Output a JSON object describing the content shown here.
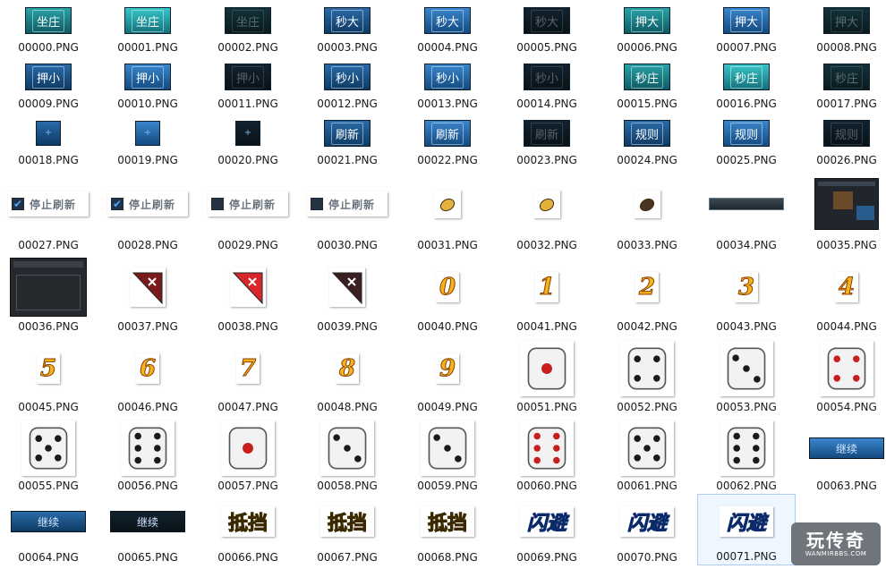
{
  "files": [
    {
      "name": "00000.PNG",
      "kind": "btn",
      "style": "teal",
      "label": "坐庄"
    },
    {
      "name": "00001.PNG",
      "kind": "btn",
      "style": "teal-b",
      "label": "坐庄"
    },
    {
      "name": "00002.PNG",
      "kind": "btn",
      "style": "dark",
      "label": "坐庄"
    },
    {
      "name": "00003.PNG",
      "kind": "btn",
      "style": "blue",
      "label": "秒大"
    },
    {
      "name": "00004.PNG",
      "kind": "btn",
      "style": "blue-b",
      "label": "秒大"
    },
    {
      "name": "00005.PNG",
      "kind": "btn",
      "style": "darkb",
      "label": "秒大"
    },
    {
      "name": "00006.PNG",
      "kind": "btn",
      "style": "teal",
      "label": "押大"
    },
    {
      "name": "00007.PNG",
      "kind": "btn",
      "style": "blue-b",
      "label": "押大"
    },
    {
      "name": "00008.PNG",
      "kind": "btn",
      "style": "dark",
      "label": "押大"
    },
    {
      "name": "00009.PNG",
      "kind": "btn",
      "style": "blue",
      "label": "押小"
    },
    {
      "name": "00010.PNG",
      "kind": "btn",
      "style": "blue-b",
      "label": "押小"
    },
    {
      "name": "00011.PNG",
      "kind": "btn",
      "style": "darkb",
      "label": "押小"
    },
    {
      "name": "00012.PNG",
      "kind": "btn",
      "style": "blue",
      "label": "秒小"
    },
    {
      "name": "00013.PNG",
      "kind": "btn",
      "style": "blue-b",
      "label": "秒小"
    },
    {
      "name": "00014.PNG",
      "kind": "btn",
      "style": "darkb",
      "label": "秒小"
    },
    {
      "name": "00015.PNG",
      "kind": "btn",
      "style": "teal",
      "label": "秒庄"
    },
    {
      "name": "00016.PNG",
      "kind": "btn",
      "style": "teal-b",
      "label": "秒庄"
    },
    {
      "name": "00017.PNG",
      "kind": "btn",
      "style": "dark",
      "label": "秒庄"
    },
    {
      "name": "00018.PNG",
      "kind": "sq",
      "style": "blue"
    },
    {
      "name": "00019.PNG",
      "kind": "sq",
      "style": "blue-b"
    },
    {
      "name": "00020.PNG",
      "kind": "sq",
      "style": "darkb"
    },
    {
      "name": "00021.PNG",
      "kind": "btn",
      "style": "blue",
      "label": "刷新"
    },
    {
      "name": "00022.PNG",
      "kind": "btn",
      "style": "blue-b",
      "label": "刷新"
    },
    {
      "name": "00023.PNG",
      "kind": "btn",
      "style": "darkb",
      "label": "刷新"
    },
    {
      "name": "00024.PNG",
      "kind": "btn",
      "style": "blue",
      "label": "规则"
    },
    {
      "name": "00025.PNG",
      "kind": "btn",
      "style": "blue-b",
      "label": "规则"
    },
    {
      "name": "00026.PNG",
      "kind": "btn",
      "style": "darkb",
      "label": "规则"
    },
    {
      "name": "00027.PNG",
      "kind": "stop",
      "checked": true,
      "label": "停止刷新"
    },
    {
      "name": "00028.PNG",
      "kind": "stop",
      "checked": true,
      "label": "停止刷新"
    },
    {
      "name": "00029.PNG",
      "kind": "stop",
      "checked": false,
      "label": "停止刷新"
    },
    {
      "name": "00030.PNG",
      "kind": "stop",
      "checked": false,
      "label": "停止刷新"
    },
    {
      "name": "00031.PNG",
      "kind": "coin",
      "color": "#e4b23a"
    },
    {
      "name": "00032.PNG",
      "kind": "coin",
      "color": "#e4b23a"
    },
    {
      "name": "00033.PNG",
      "kind": "coin",
      "color": "#4a3424"
    },
    {
      "name": "00034.PNG",
      "kind": "bar"
    },
    {
      "name": "00035.PNG",
      "kind": "panel"
    },
    {
      "name": "00036.PNG",
      "kind": "panel2"
    },
    {
      "name": "00037.PNG",
      "kind": "corner",
      "color": "#7a1a1a"
    },
    {
      "name": "00038.PNG",
      "kind": "corner",
      "color": "#d8262a"
    },
    {
      "name": "00039.PNG",
      "kind": "corner",
      "color": "#3a2020"
    },
    {
      "name": "00040.PNG",
      "kind": "digit",
      "label": "0"
    },
    {
      "name": "00041.PNG",
      "kind": "digit",
      "label": "1"
    },
    {
      "name": "00042.PNG",
      "kind": "digit",
      "label": "2"
    },
    {
      "name": "00043.PNG",
      "kind": "digit",
      "label": "3"
    },
    {
      "name": "00044.PNG",
      "kind": "digit",
      "label": "4"
    },
    {
      "name": "00045.PNG",
      "kind": "digit",
      "label": "5"
    },
    {
      "name": "00046.PNG",
      "kind": "digit",
      "label": "6"
    },
    {
      "name": "00047.PNG",
      "kind": "digit",
      "label": "7"
    },
    {
      "name": "00048.PNG",
      "kind": "digit",
      "label": "8"
    },
    {
      "name": "00049.PNG",
      "kind": "digit",
      "label": "9"
    },
    {
      "name": "00051.PNG",
      "kind": "die",
      "pips": 1,
      "red": true
    },
    {
      "name": "00052.PNG",
      "kind": "die",
      "pips": 4,
      "red": false
    },
    {
      "name": "00053.PNG",
      "kind": "die",
      "pips": 3,
      "red": false
    },
    {
      "name": "00054.PNG",
      "kind": "die",
      "pips": 4,
      "red": true
    },
    {
      "name": "00055.PNG",
      "kind": "die",
      "pips": 5,
      "red": false
    },
    {
      "name": "00056.PNG",
      "kind": "die",
      "pips": 6,
      "red": false
    },
    {
      "name": "00057.PNG",
      "kind": "die",
      "pips": 1,
      "red": true
    },
    {
      "name": "00058.PNG",
      "kind": "die",
      "pips": 3,
      "red": false
    },
    {
      "name": "00059.PNG",
      "kind": "die",
      "pips": 3,
      "red": false
    },
    {
      "name": "00060.PNG",
      "kind": "die",
      "pips": 6,
      "red": true
    },
    {
      "name": "00061.PNG",
      "kind": "die",
      "pips": 5,
      "red": false
    },
    {
      "name": "00062.PNG",
      "kind": "die",
      "pips": 6,
      "red": false
    },
    {
      "name": "00063.PNG",
      "kind": "long",
      "style": "blue-b",
      "label": "继续"
    },
    {
      "name": "00064.PNG",
      "kind": "long",
      "style": "blue",
      "label": "继续"
    },
    {
      "name": "00065.PNG",
      "kind": "long",
      "style": "darkb",
      "label": "继续"
    },
    {
      "name": "00066.PNG",
      "kind": "cal",
      "label": "抵挡"
    },
    {
      "name": "00067.PNG",
      "kind": "cal",
      "label": "抵挡"
    },
    {
      "name": "00068.PNG",
      "kind": "cal",
      "label": "抵挡"
    },
    {
      "name": "00069.PNG",
      "kind": "dodge",
      "label": "闪避"
    },
    {
      "name": "00070.PNG",
      "kind": "dodge",
      "label": "闪避"
    },
    {
      "name": "00071.PNG",
      "kind": "dodge",
      "label": "闪避",
      "selected": true
    }
  ],
  "watermark": {
    "title": "玩传奇",
    "url": "WANMIRBBS.COM"
  }
}
